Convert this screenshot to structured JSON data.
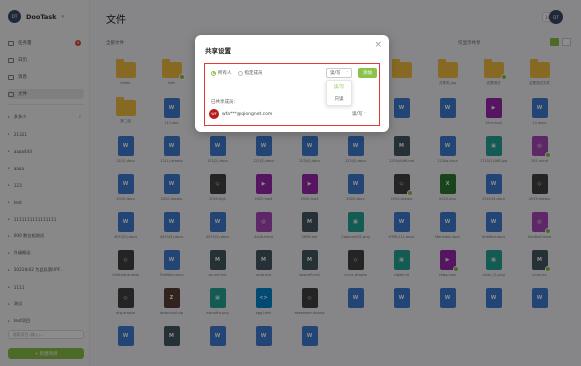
{
  "app": {
    "avatar_text": "DT",
    "name": "DooTask"
  },
  "sidebar": {
    "nav": [
      {
        "label": "任务量",
        "badge": "9"
      },
      {
        "label": "日历",
        "badge": ""
      },
      {
        "label": "消息",
        "badge": ""
      },
      {
        "label": "文件",
        "badge": ""
      }
    ],
    "projects": [
      {
        "label": "多多少",
        "count": "2"
      },
      {
        "label": "21321",
        "count": ""
      },
      {
        "label": "aaaa444",
        "count": ""
      },
      {
        "label": "aaaa",
        "count": ""
      },
      {
        "label": "123",
        "count": ""
      },
      {
        "label": "test",
        "count": ""
      },
      {
        "label": "1111111111111111",
        "count": ""
      },
      {
        "label": "000 数位相测试",
        "count": ""
      },
      {
        "label": "升级概念",
        "count": ""
      },
      {
        "label": "2021年02 为此队第UPF...",
        "count": ""
      },
      {
        "label": "1111",
        "count": ""
      },
      {
        "label": "测试",
        "count": ""
      },
      {
        "label": "test项目",
        "count": ""
      }
    ],
    "search_placeholder": "搜索项目 (输入)...",
    "new_project_label": "+ 新建项目"
  },
  "main": {
    "title": "文件",
    "breadcrumb": "全部文件",
    "share_view_label": "仅显示共享",
    "header_icons": {
      "sort_icon": "1L",
      "search_icon": "Q"
    },
    "user_avatar": "DT"
  },
  "files": [
    {
      "name": "folder",
      "type": "folder",
      "shared": false
    },
    {
      "name": "test",
      "type": "folder",
      "shared": true
    },
    {
      "name": "文件",
      "type": "folder",
      "shared": false
    },
    {
      "name": "",
      "type": "folder",
      "shared": false
    },
    {
      "name": "",
      "type": "folder",
      "shared": false
    },
    {
      "name": "",
      "type": "folder",
      "shared": false
    },
    {
      "name": "",
      "type": "folder",
      "shared": false
    },
    {
      "name": "共享夹.jpg",
      "type": "folder",
      "shared": false
    },
    {
      "name": "这是测试",
      "type": "folder",
      "shared": true
    },
    {
      "name": "这是测试文件",
      "type": "folder",
      "shared": false
    },
    {
      "name": "第二组",
      "type": "folder",
      "shared": false
    },
    {
      "name": "111.doc",
      "type": "doc",
      "shared": false
    },
    {
      "name": "12.ppt",
      "type": "ppt",
      "shared": true
    },
    {
      "name": "1211.draw",
      "type": "draw",
      "shared": false
    },
    {
      "name": "1231.docx",
      "type": "doc",
      "shared": false
    },
    {
      "name": "",
      "type": "doc",
      "shared": false
    },
    {
      "name": "",
      "type": "doc",
      "shared": false
    },
    {
      "name": "",
      "type": "doc",
      "shared": false
    },
    {
      "name": "12m.mp4",
      "type": "video",
      "shared": false
    },
    {
      "name": "12.docx",
      "type": "doc",
      "shared": false
    },
    {
      "name": "12(1).docx",
      "type": "doc",
      "shared": false
    },
    {
      "name": "12(1).drawio",
      "type": "doc",
      "shared": false
    },
    {
      "name": "123(2).docx",
      "type": "doc",
      "shared": false
    },
    {
      "name": "123(3).docx",
      "type": "doc",
      "shared": false
    },
    {
      "name": "123(4).docx",
      "type": "doc",
      "shared": false
    },
    {
      "name": "123(5).docx",
      "type": "doc",
      "shared": false
    },
    {
      "name": "1234(6)96.md",
      "type": "md",
      "shared": false
    },
    {
      "name": "1234a.docx",
      "type": "doc",
      "shared": false
    },
    {
      "name": "1715(2)368.jpg",
      "type": "img",
      "shared": false
    },
    {
      "name": "201.mind",
      "type": "mind",
      "shared": true
    },
    {
      "name": "2020.docx",
      "type": "doc",
      "shared": false
    },
    {
      "name": "2020.drawio",
      "type": "doc",
      "shared": false
    },
    {
      "name": "2020.fig2",
      "type": "draw",
      "shared": false
    },
    {
      "name": "2020.mp4",
      "type": "video",
      "shared": false
    },
    {
      "name": "2020.mp4",
      "type": "video",
      "shared": false
    },
    {
      "name": "2020.docx",
      "type": "doc",
      "shared": false
    },
    {
      "name": "2020.drawio",
      "type": "draw",
      "shared": true
    },
    {
      "name": "2020.xlsx",
      "type": "xls",
      "shared": false
    },
    {
      "name": "234234.docx",
      "type": "doc",
      "shared": false
    },
    {
      "name": "4533.drawio",
      "type": "draw",
      "shared": false
    },
    {
      "name": "4533(2).docx",
      "type": "doc",
      "shared": false
    },
    {
      "name": "4533(3).docx",
      "type": "doc",
      "shared": false
    },
    {
      "name": "4533(5).docx",
      "type": "doc",
      "shared": false
    },
    {
      "name": "4a2b.mind",
      "type": "mind",
      "shared": false
    },
    {
      "name": "5656.md",
      "type": "md",
      "shared": false
    },
    {
      "name": "Capture001.png",
      "type": "img",
      "shared": false
    },
    {
      "name": "HTML111.docx",
      "type": "doc",
      "shared": false
    },
    {
      "name": "Mermaid.docx",
      "type": "doc",
      "shared": false
    },
    {
      "name": "Untitled.docx",
      "type": "doc",
      "shared": false
    },
    {
      "name": "Untitled.mind",
      "type": "mind",
      "shared": true
    },
    {
      "name": "Untitled.drawio",
      "type": "draw",
      "shared": false
    },
    {
      "name": "TheMain.docx",
      "type": "doc",
      "shared": false
    },
    {
      "name": "ax.md.md",
      "type": "md",
      "shared": false
    },
    {
      "name": "auto.md",
      "type": "md",
      "shared": false
    },
    {
      "name": "axw.left.md",
      "type": "md",
      "shared": false
    },
    {
      "name": "ccccc.drawio",
      "type": "draw",
      "shared": false
    },
    {
      "name": "clgitle.dt",
      "type": "img",
      "shared": false
    },
    {
      "name": "cbqq.mov",
      "type": "video",
      "shared": true
    },
    {
      "name": "chian_f1.png",
      "type": "img",
      "shared": false
    },
    {
      "name": "cmd.ccc",
      "type": "md",
      "shared": true
    },
    {
      "name": "dtg.drawio",
      "type": "draw",
      "shared": false
    },
    {
      "name": "download.zip",
      "type": "zip",
      "shared": false
    },
    {
      "name": "ezmotto.png",
      "type": "img",
      "shared": false
    },
    {
      "name": "egg.html",
      "type": "html",
      "shared": false
    },
    {
      "name": "eeeeeeee.drawio",
      "type": "draw",
      "shared": false
    },
    {
      "name": "",
      "type": "doc",
      "shared": false
    },
    {
      "name": "",
      "type": "doc",
      "shared": false
    },
    {
      "name": "",
      "type": "doc",
      "shared": false
    },
    {
      "name": "",
      "type": "doc",
      "shared": false
    },
    {
      "name": "",
      "type": "doc",
      "shared": false
    },
    {
      "name": "",
      "type": "doc",
      "shared": false
    },
    {
      "name": "",
      "type": "md",
      "shared": false
    },
    {
      "name": "",
      "type": "doc",
      "shared": false
    },
    {
      "name": "",
      "type": "doc",
      "shared": false
    },
    {
      "name": "",
      "type": "doc",
      "shared": false
    }
  ],
  "modal": {
    "title": "共享设置",
    "radio_all": "所有人",
    "radio_specific": "指定成员",
    "permission_value": "读/写",
    "add_button": "添加",
    "dropdown_options": [
      "读/写",
      "只读"
    ],
    "shared_members_title": "已共享成员:",
    "member": {
      "avatar_text": "WF",
      "email": "wfa***@qiongnet.com",
      "permission": "读/写"
    }
  },
  "colors": {
    "accent": "#8bc34a",
    "highlight_border": "#e53935",
    "folder": "#f5c242"
  }
}
